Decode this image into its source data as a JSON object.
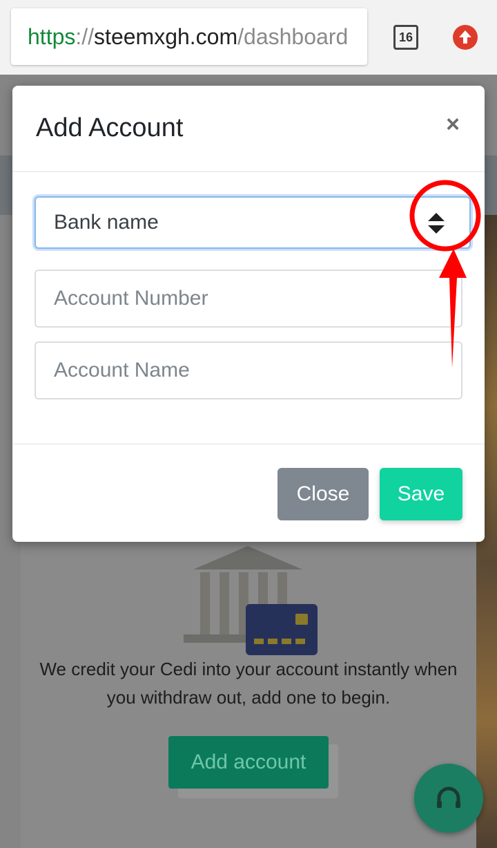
{
  "browser": {
    "url_scheme": "https",
    "url_separator": "://",
    "url_host": "steemxgh.com",
    "url_path": "/dashboard",
    "tab_count": "16"
  },
  "background_page": {
    "message": "We credit your Cedi into your account instantly when you withdraw out, add one to begin.",
    "add_account_label": "Add account",
    "fab_icon": "headset-icon"
  },
  "modal": {
    "title": "Add Account",
    "close_icon": "×",
    "bank_select": {
      "value": "Bank name"
    },
    "account_number": {
      "placeholder": "Account Number",
      "value": ""
    },
    "account_name": {
      "placeholder": "Account Name",
      "value": ""
    },
    "close_label": "Close",
    "save_label": "Save"
  },
  "colors": {
    "save_button": "#10d3a0",
    "close_button": "#7f8890",
    "annotation": "#ff0000",
    "url_scheme": "#138a3a"
  }
}
